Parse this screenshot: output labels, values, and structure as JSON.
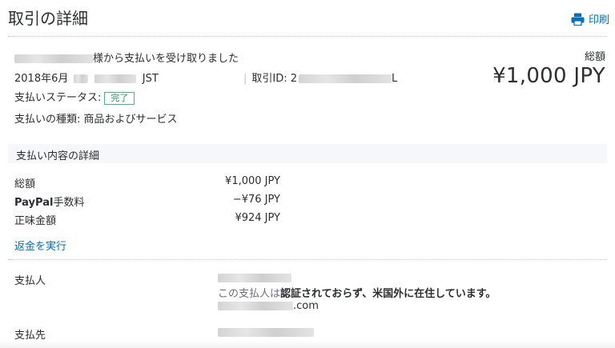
{
  "header": {
    "title": "取引の詳細",
    "print_label": "印刷"
  },
  "summary": {
    "received_text": "様から支払いを受け取りました",
    "date_prefix": "2018年6月",
    "timezone": "JST",
    "transaction_id_label": "取引ID: 2",
    "transaction_id_suffix": "L",
    "total_label": "総額",
    "total_amount": "¥1,000 JPY",
    "status_label": "支払いステータス:",
    "status_value": "完了",
    "type_label": "支払いの種類: 商品およびサービス"
  },
  "details": {
    "section_title": "支払い内容の詳細",
    "rows": [
      {
        "label_bold": "",
        "label": "総額",
        "value": "¥1,000 JPY"
      },
      {
        "label_bold": "PayPal",
        "label": "手数料",
        "value": "−¥76 JPY"
      },
      {
        "label_bold": "",
        "label": "正味金額",
        "value": "¥924 JPY"
      }
    ],
    "refund_link": "返金を実行"
  },
  "payer": {
    "label": "支払人",
    "warning_part1": "この支払人は",
    "warning_part2": "認証",
    "warning_part3": "されておらず、米国外に在住しています。",
    "email_suffix": ".com"
  },
  "payee": {
    "label": "支払先"
  },
  "colors": {
    "link": "#0070ba",
    "status_border": "#4ab38a",
    "section_band": "#f5f7fa"
  },
  "icons": {
    "print": "printer-icon"
  }
}
